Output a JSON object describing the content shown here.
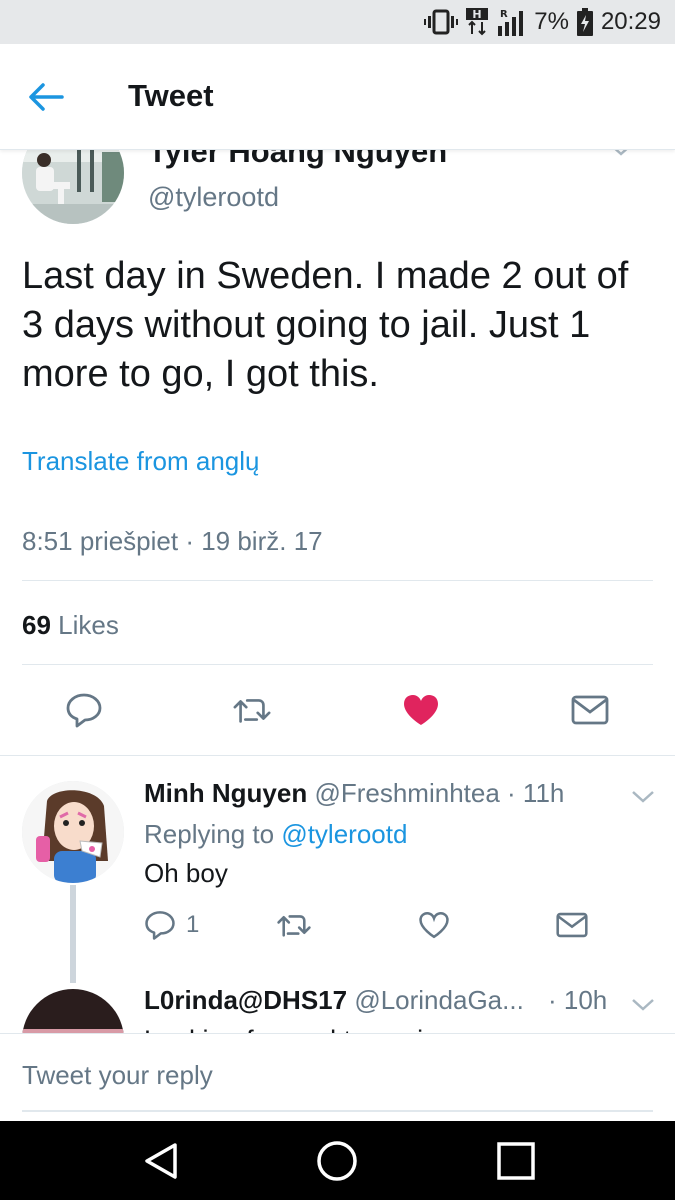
{
  "status_bar": {
    "battery": "7%",
    "time": "20:29",
    "network_badge": "H",
    "roaming_badge": "R",
    "icons": [
      "vibrate-icon",
      "data-transfer-icon",
      "signal-icon",
      "battery-charging-icon"
    ]
  },
  "app_bar": {
    "title": "Tweet",
    "back_icon": "back-arrow-icon"
  },
  "main_tweet": {
    "author_name": "Tyler Hoang Nguyen",
    "author_handle": "@tylerootd",
    "text": "Last day in Sweden. I made 2 out of 3 days without going to jail. Just 1 more to go, I got this.",
    "translate_label": "Translate from anglų",
    "timestamp": "8:51 priešpiet · 19 birž. 17",
    "likes_count": "69",
    "likes_label": "Likes",
    "liked": true
  },
  "replies": [
    {
      "name": "Minh Nguyen",
      "handle": "@Freshminhtea",
      "time": "· 11h",
      "replying_prefix": "Replying to",
      "replying_to": "@tylerootd",
      "text": "Oh boy",
      "reply_count": "1"
    },
    {
      "name": "L0rinda@DHS17",
      "handle": "@LorindaGa...",
      "time": "· 10h",
      "text": "Looking forward to seeing you guys"
    }
  ],
  "reply_box": {
    "placeholder": "Tweet your reply"
  },
  "colors": {
    "accent": "#1b95e0",
    "like_active": "#e0245e",
    "secondary_text": "#657786",
    "divider": "#e1e8ed"
  }
}
